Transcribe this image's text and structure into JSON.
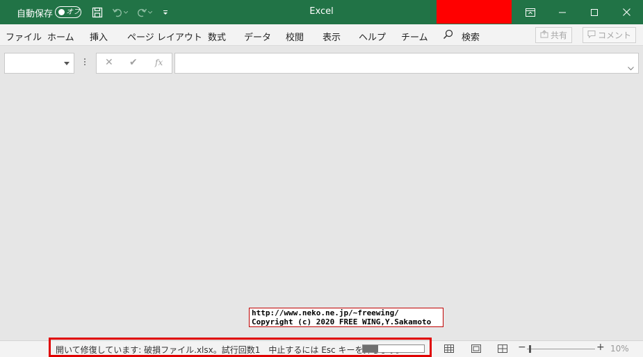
{
  "titlebar": {
    "autosave_label": "自動保存",
    "autosave_state": "オフ",
    "app_title": "Excel",
    "colors": {
      "bg": "#217346",
      "redacted": "#ff0000"
    }
  },
  "ribbon": {
    "tabs": [
      "ファイル",
      "ホーム",
      "挿入",
      "ページ レイアウト",
      "数式",
      "データ",
      "校閲",
      "表示",
      "ヘルプ",
      "チーム"
    ],
    "search_label": "検索",
    "share_label": "共有",
    "comment_label": "コメント"
  },
  "formula_bar": {
    "namebox_value": "",
    "formula_value": "",
    "fx_label": "fx"
  },
  "watermark": {
    "line1": "http://www.neko.ne.jp/~freewing/",
    "line2": "Copyright (c) 2020 FREE WING,Y.Sakamoto"
  },
  "statusbar": {
    "message": "開いて修復しています: 破損ファイル.xlsx。試行回数1　中止するには Esc キーを押します。",
    "progress": 0.25,
    "zoom_level": "10%",
    "zoom_fraction": 0.04
  }
}
